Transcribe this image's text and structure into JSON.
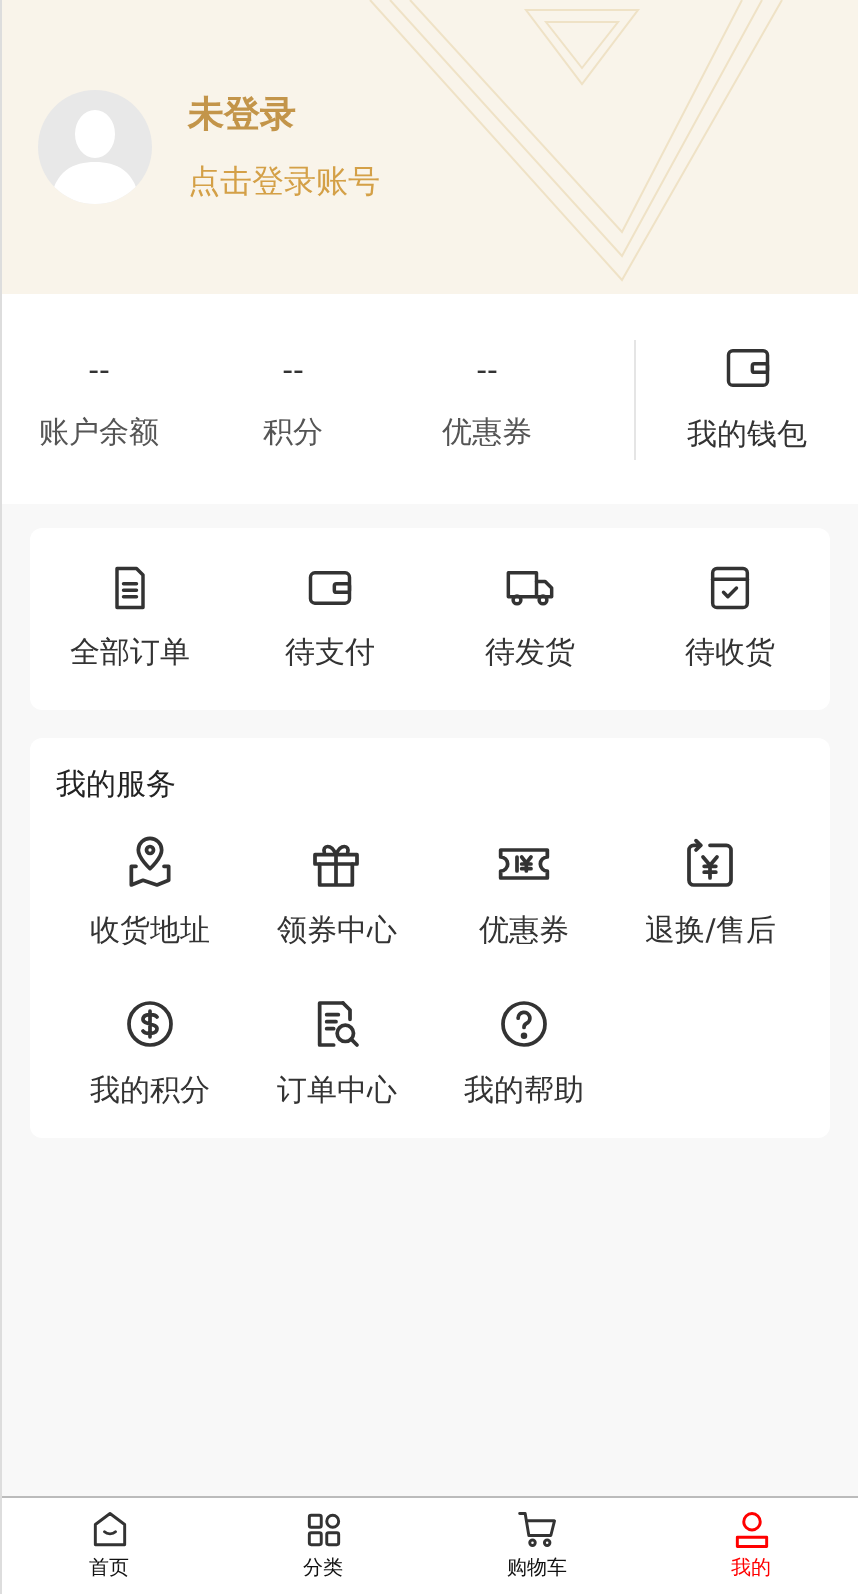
{
  "profile": {
    "name": "未登录",
    "subtitle": "点击登录账号"
  },
  "stats": [
    {
      "value": "--",
      "label": "账户余额"
    },
    {
      "value": "--",
      "label": "积分"
    },
    {
      "value": "--",
      "label": "优惠券"
    }
  ],
  "wallet": {
    "label": "我的钱包"
  },
  "orders": [
    {
      "label": "全部订单"
    },
    {
      "label": "待支付"
    },
    {
      "label": "待发货"
    },
    {
      "label": "待收货"
    }
  ],
  "services": {
    "title": "我的服务",
    "items": [
      {
        "label": "收货地址"
      },
      {
        "label": "领券中心"
      },
      {
        "label": "优惠券"
      },
      {
        "label": "退换/售后"
      },
      {
        "label": "我的积分"
      },
      {
        "label": "订单中心"
      },
      {
        "label": "我的帮助"
      }
    ]
  },
  "tab_bar": [
    {
      "label": "首页",
      "selected": false
    },
    {
      "label": "分类",
      "selected": false
    },
    {
      "label": "购物车",
      "selected": false
    },
    {
      "label": "我的",
      "selected": true
    }
  ]
}
